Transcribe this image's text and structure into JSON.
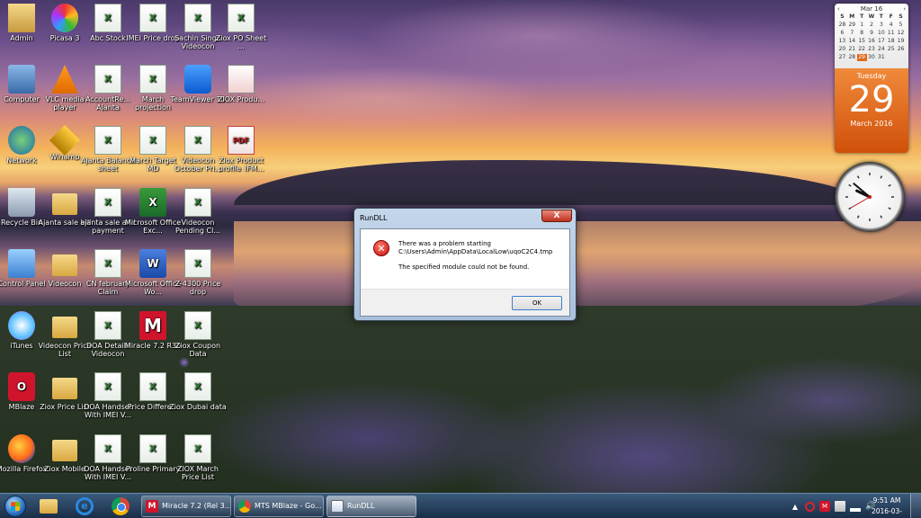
{
  "desktop": {
    "icons": [
      {
        "label": "Admin",
        "type": "user"
      },
      {
        "label": "Picasa 3",
        "type": "picasa"
      },
      {
        "label": "Abc Stock",
        "type": "xls"
      },
      {
        "label": "IMEI Price drop",
        "type": "xls"
      },
      {
        "label": "Sachin Singh Videocon",
        "type": "xls"
      },
      {
        "label": "Ziox PO Sheet ...",
        "type": "xls"
      },
      {
        "label": "Computer",
        "type": "computer"
      },
      {
        "label": "VLC media player",
        "type": "vlc"
      },
      {
        "label": "AccountRe... Ajanta",
        "type": "xls"
      },
      {
        "label": "March projection",
        "type": "xls"
      },
      {
        "label": "TeamViewer 10",
        "type": "teamviewer"
      },
      {
        "label": "ZIOX Produ...",
        "type": "shortcut"
      },
      {
        "label": "Network",
        "type": "network"
      },
      {
        "label": "Winamp",
        "type": "winamp"
      },
      {
        "label": "Ajanta Balance sheet",
        "type": "xls"
      },
      {
        "label": "March Target MD",
        "type": "xls"
      },
      {
        "label": "Videocon October Pri...",
        "type": "xls"
      },
      {
        "label": "Ziox Product profile_IFM...",
        "type": "pdf"
      },
      {
        "label": "Recycle Bin",
        "type": "recycle"
      },
      {
        "label": "Ajanta sale bill",
        "type": "folder"
      },
      {
        "label": "ajanta sale and payment",
        "type": "xls"
      },
      {
        "label": "Microsoft Office Exc...",
        "type": "exceldoc"
      },
      {
        "label": "Videocon Pending Cl...",
        "type": "xls"
      },
      {
        "label": "Control Panel",
        "type": "control"
      },
      {
        "label": "Videocon",
        "type": "folder"
      },
      {
        "label": "CN february Claim",
        "type": "xls"
      },
      {
        "label": "Microsoft Office Wo...",
        "type": "worddoc"
      },
      {
        "label": "Z-4300 Price drop",
        "type": "xls"
      },
      {
        "label": "iTunes",
        "type": "itunes"
      },
      {
        "label": "Videocon Price List",
        "type": "folder"
      },
      {
        "label": "DOA Details Videocon",
        "type": "xls"
      },
      {
        "label": "Miracle 7.2 R30",
        "type": "miracle"
      },
      {
        "label": "Ziox Coupon Data",
        "type": "xls"
      },
      {
        "label": "MBlaze",
        "type": "mblaze"
      },
      {
        "label": "Ziox Price List",
        "type": "folder"
      },
      {
        "label": "DOA Handset With IMEI V...",
        "type": "xls"
      },
      {
        "label": "Price Differe...",
        "type": "xls"
      },
      {
        "label": "Ziox Dubai data",
        "type": "xls"
      },
      {
        "label": "Mozilla Firefox",
        "type": "firefox"
      },
      {
        "label": "Ziox Mobile",
        "type": "folder"
      },
      {
        "label": "DOA Handset With IMEI V...",
        "type": "xls"
      },
      {
        "label": "Proline Primary",
        "type": "xls"
      },
      {
        "label": "ZIOX March Price List",
        "type": "xls"
      }
    ]
  },
  "calendar_gadget": {
    "month_label": "Mar 16",
    "prev": "‹",
    "next": "›",
    "weekdays": [
      "S",
      "M",
      "T",
      "W",
      "T",
      "F",
      "S"
    ],
    "days": [
      "28",
      "29",
      "1",
      "2",
      "3",
      "4",
      "5",
      "6",
      "7",
      "8",
      "9",
      "10",
      "11",
      "12",
      "13",
      "14",
      "15",
      "16",
      "17",
      "18",
      "19",
      "20",
      "21",
      "22",
      "23",
      "24",
      "25",
      "26",
      "27",
      "28",
      "29",
      "30",
      "31"
    ],
    "today_index": 30,
    "weekday": "Tuesday",
    "day_number": "29",
    "month_year": "March 2016"
  },
  "clock_gadget": {
    "hour": 9,
    "minute": 51,
    "second": 40
  },
  "dialog": {
    "title": "RunDLL",
    "close_label": "X",
    "message_line1": "There was a problem starting",
    "message_line2": "C:\\Users\\Admin\\AppData\\LocalLow\\uqoC2C4.tmp",
    "message_line3": "The specified module could not be found.",
    "ok_label": "OK",
    "error_icon": "error-icon"
  },
  "taskbar": {
    "tasks": [
      {
        "label": "Miracle 7.2 (Rel 3....",
        "icon": "miracle-icon",
        "active": false
      },
      {
        "label": "MTS MBlaze - Go...",
        "icon": "chrome-icon",
        "active": false
      },
      {
        "label": "RunDLL",
        "icon": "rundll-icon",
        "active": true
      }
    ],
    "tray": {
      "time": "9:51 AM",
      "date": "2016-03-29"
    }
  },
  "colors": {
    "accent": "#e06a1a",
    "taskbar": "#1a2e48",
    "dialog_frame": "#b4cae2",
    "error": "#c01010"
  }
}
